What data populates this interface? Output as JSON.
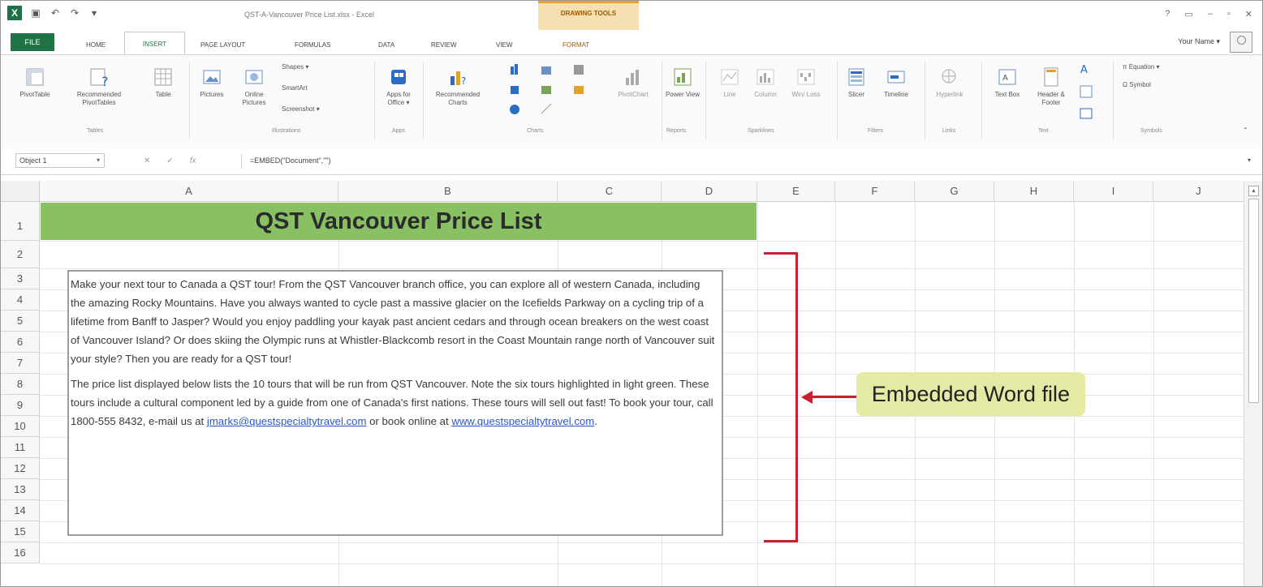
{
  "window": {
    "title": "QST-A-Vancouver Price List.xlsx - Excel",
    "contextual_tab_group": "DRAWING TOOLS",
    "controls": [
      "?",
      "▭",
      "–",
      "▫",
      "✕"
    ]
  },
  "ribbon_tabs": {
    "file": "FILE",
    "tabs": [
      "HOME",
      "INSERT",
      "PAGE LAYOUT",
      "FORMULAS",
      "DATA",
      "REVIEW",
      "VIEW",
      "FORMAT"
    ],
    "active": "INSERT",
    "user": "Your Name ▾"
  },
  "ribbon": {
    "pivottable": "PivotTable",
    "rec_pivottables": "Recommended PivotTables",
    "table": "Table",
    "tables_group": "Tables",
    "pictures": "Pictures",
    "online_pictures": "Online Pictures",
    "shapes": "Shapes ▾",
    "smartart": "SmartArt",
    "screenshot": "Screenshot ▾",
    "illustrations_group": "Illustrations",
    "apps_for_office": "Apps for Office ▾",
    "apps_group": "Apps",
    "rec_charts": "Recommended Charts",
    "pivotchart": "PivotChart",
    "charts_group": "Charts",
    "power_view": "Power View",
    "reports_group": "Reports",
    "line": "Line",
    "column": "Column",
    "winloss": "Win/ Loss",
    "sparklines_group": "Sparklines",
    "slicer": "Slicer",
    "timeline": "Timeline",
    "filters_group": "Filters",
    "hyperlink": "Hyperlink",
    "links_group": "Links",
    "textbox": "Text Box",
    "header_footer": "Header & Footer",
    "text_group": "Text",
    "equation": "π Equation ▾",
    "symbol": "Ω Symbol",
    "symbols_group": "Symbols"
  },
  "formula_bar": {
    "name_box": "Object 1",
    "formula": "=EMBED(\"Document\",\"\")"
  },
  "sheet": {
    "columns": [
      "A",
      "B",
      "C",
      "D",
      "E",
      "F",
      "G",
      "H",
      "I",
      "J"
    ],
    "rows": [
      "1",
      "2",
      "3",
      "4",
      "5",
      "6",
      "7",
      "8",
      "9",
      "10",
      "11",
      "12",
      "13",
      "14",
      "15",
      "16"
    ],
    "title": "QST Vancouver Price List"
  },
  "embedded_doc": {
    "para1": "Make your next tour to Canada a QST tour! From the QST Vancouver branch office, you can explore all of western Canada, including the amazing Rocky Mountains. Have you always wanted to cycle past a massive glacier on the Icefields Parkway on a cycling trip of a lifetime from Banff to Jasper? Would you enjoy paddling your kayak past ancient cedars and through ocean breakers on the west coast of Vancouver Island? Or does skiing the Olympic runs at Whistler-Blackcomb resort in the Coast Mountain range north of Vancouver suit your style? Then you are ready for a QST tour!",
    "para2_start": "The price list displayed below lists the 10 tours that will be run from QST Vancouver.  Note the six tours highlighted in light green. These tours include a cultural component led by a guide from one of Canada's first nations. These tours will sell out fast! To book your tour, call 1800-555 8432, e-mail us at ",
    "email": "jmarks@questspecialtytravel.com",
    "mid": " or book online at ",
    "website": "www.questspecialtytravel.com",
    "end": "."
  },
  "callout": {
    "label": "Embedded Word file"
  },
  "colors": {
    "excel_green": "#217346",
    "title_band": "#88c063",
    "callout_bg": "#e4e9a3",
    "bracket_red": "#c9202f",
    "link_blue": "#2b57c9"
  }
}
